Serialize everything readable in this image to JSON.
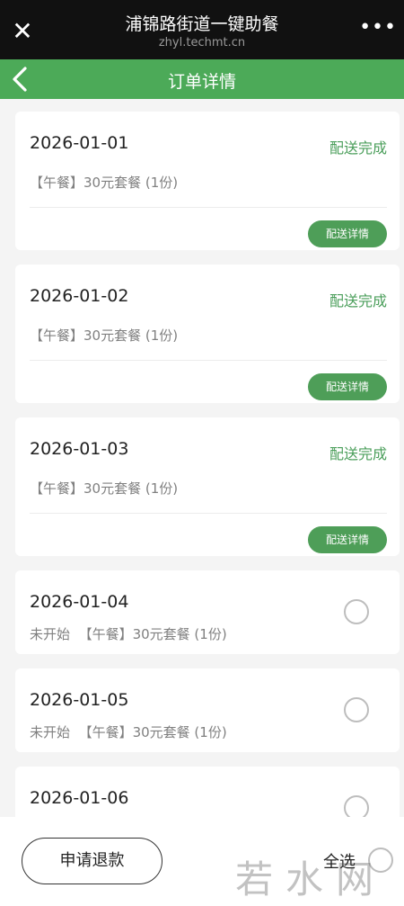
{
  "app": {
    "title": "浦锦路街道一键助餐",
    "url": "zhyl.techmt.cn"
  },
  "icons": {
    "close": "close-icon",
    "more": "more-icon",
    "back": "back-arrow-icon"
  },
  "colors": {
    "nav_green": "#4caa58",
    "status_green": "#4a9e5a",
    "button_green": "#4e9e58"
  },
  "nav": {
    "title": "订单详情"
  },
  "orders": [
    {
      "date": "2026-01-01",
      "status": "配送完成",
      "meal": "【午餐】30元套餐 (1份)",
      "button": "配送详情"
    },
    {
      "date": "2026-01-02",
      "status": "配送完成",
      "meal": "【午餐】30元套餐 (1份)",
      "button": "配送详情"
    },
    {
      "date": "2026-01-03",
      "status": "配送完成",
      "meal": "【午餐】30元套餐 (1份)",
      "button": "配送详情"
    },
    {
      "date": "2026-01-04",
      "status": "未开始",
      "meal": "【午餐】30元套餐 (1份)"
    },
    {
      "date": "2026-01-05",
      "status": "未开始",
      "meal": "【午餐】30元套餐 (1份)"
    },
    {
      "date": "2026-01-06"
    }
  ],
  "bottom": {
    "refund_label": "申请退款",
    "select_all_label": "全选"
  },
  "watermark": {
    "text": "若水网"
  }
}
